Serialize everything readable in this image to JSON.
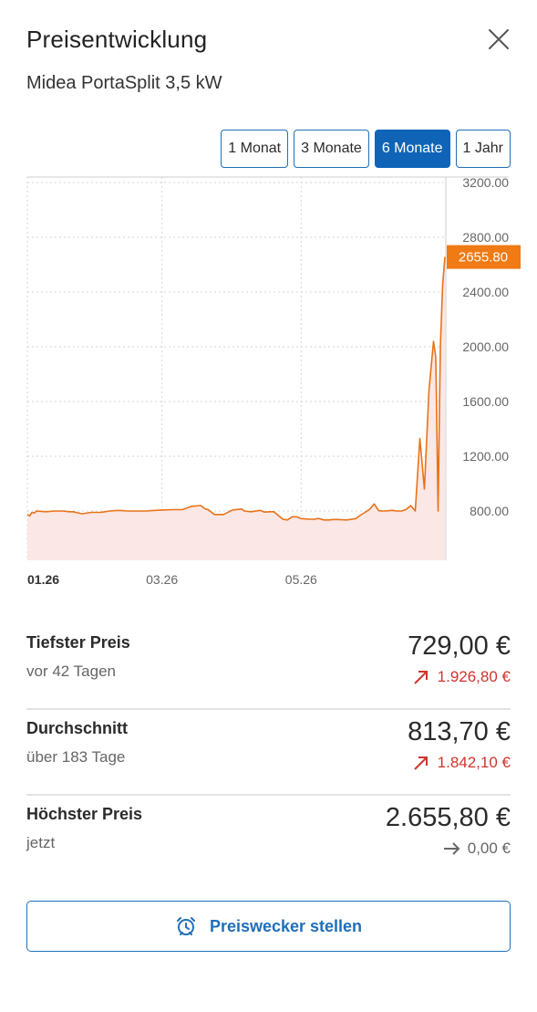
{
  "header": {
    "title": "Preisentwicklung",
    "close_icon": "close-icon"
  },
  "product": {
    "name": "Midea PortaSplit 3,5 kW"
  },
  "range_tabs": [
    {
      "label": "1 Monat",
      "active": false
    },
    {
      "label": "3 Monate",
      "active": false
    },
    {
      "label": "6 Monate",
      "active": true
    },
    {
      "label": "1 Jahr",
      "active": false
    }
  ],
  "chart_data": {
    "type": "line",
    "title": "",
    "xlabel": "",
    "ylabel": "",
    "ylim": [
      480,
      3200
    ],
    "yticks": [
      "3200.00",
      "2800.00",
      "2400.00",
      "2000.00",
      "1600.00",
      "1200.00",
      "800.00"
    ],
    "xticks": [
      {
        "label": "01.26",
        "day": 0,
        "bold": true
      },
      {
        "label": "03.26",
        "day": 59,
        "bold": false
      },
      {
        "label": "05.26",
        "day": 120,
        "bold": false
      }
    ],
    "current_marker": "2655.80",
    "colors": {
      "line": "#e8731a",
      "fill": "#fbe7e5",
      "marker": "#f07a14"
    },
    "series": [
      {
        "x": [
          0,
          1,
          2,
          3,
          4,
          8,
          12,
          16,
          18,
          20,
          24,
          28,
          32,
          34,
          36,
          40,
          44,
          48,
          52,
          56,
          60,
          64,
          68,
          72,
          76,
          78,
          79,
          82,
          86,
          90,
          94,
          95,
          98,
          102,
          104,
          106,
          108,
          112,
          114,
          116,
          118,
          120,
          124,
          126,
          127,
          128,
          130,
          132,
          134,
          136,
          140,
          144,
          146,
          148,
          150,
          152,
          154,
          156,
          158,
          160,
          162,
          164,
          166,
          168,
          170,
          172,
          174,
          176,
          178,
          179,
          180,
          181,
          182,
          183
        ],
        "y": [
          775,
          765,
          790,
          785,
          800,
          795,
          800,
          800,
          795,
          795,
          780,
          790,
          790,
          795,
          800,
          805,
          800,
          800,
          800,
          805,
          808,
          810,
          810,
          835,
          840,
          815,
          812,
          775,
          775,
          808,
          815,
          800,
          795,
          805,
          792,
          795,
          795,
          740,
          735,
          758,
          758,
          745,
          740,
          740,
          745,
          745,
          735,
          735,
          738,
          738,
          735,
          745,
          770,
          790,
          812,
          852,
          802,
          800,
          802,
          805,
          800,
          800,
          812,
          840,
          800,
          1330,
          960,
          1680,
          2040,
          1920,
          800,
          2000,
          2450,
          2655.8
        ]
      }
    ]
  },
  "stats": [
    {
      "label": "Tiefster Preis",
      "sub": "vor 42 Tagen",
      "value": "729,00 €",
      "delta": "1.926,80 €",
      "trend": "up"
    },
    {
      "label": "Durchschnitt",
      "sub": "über 183 Tage",
      "value": "813,70 €",
      "delta": "1.842,10 €",
      "trend": "up"
    },
    {
      "label": "Höchster Preis",
      "sub": "jetzt",
      "value": "2.655,80 €",
      "delta": "0,00 €",
      "trend": "flat"
    }
  ],
  "alarm_button": {
    "label": "Preiswecker stellen",
    "icon": "alarm-clock-icon"
  }
}
